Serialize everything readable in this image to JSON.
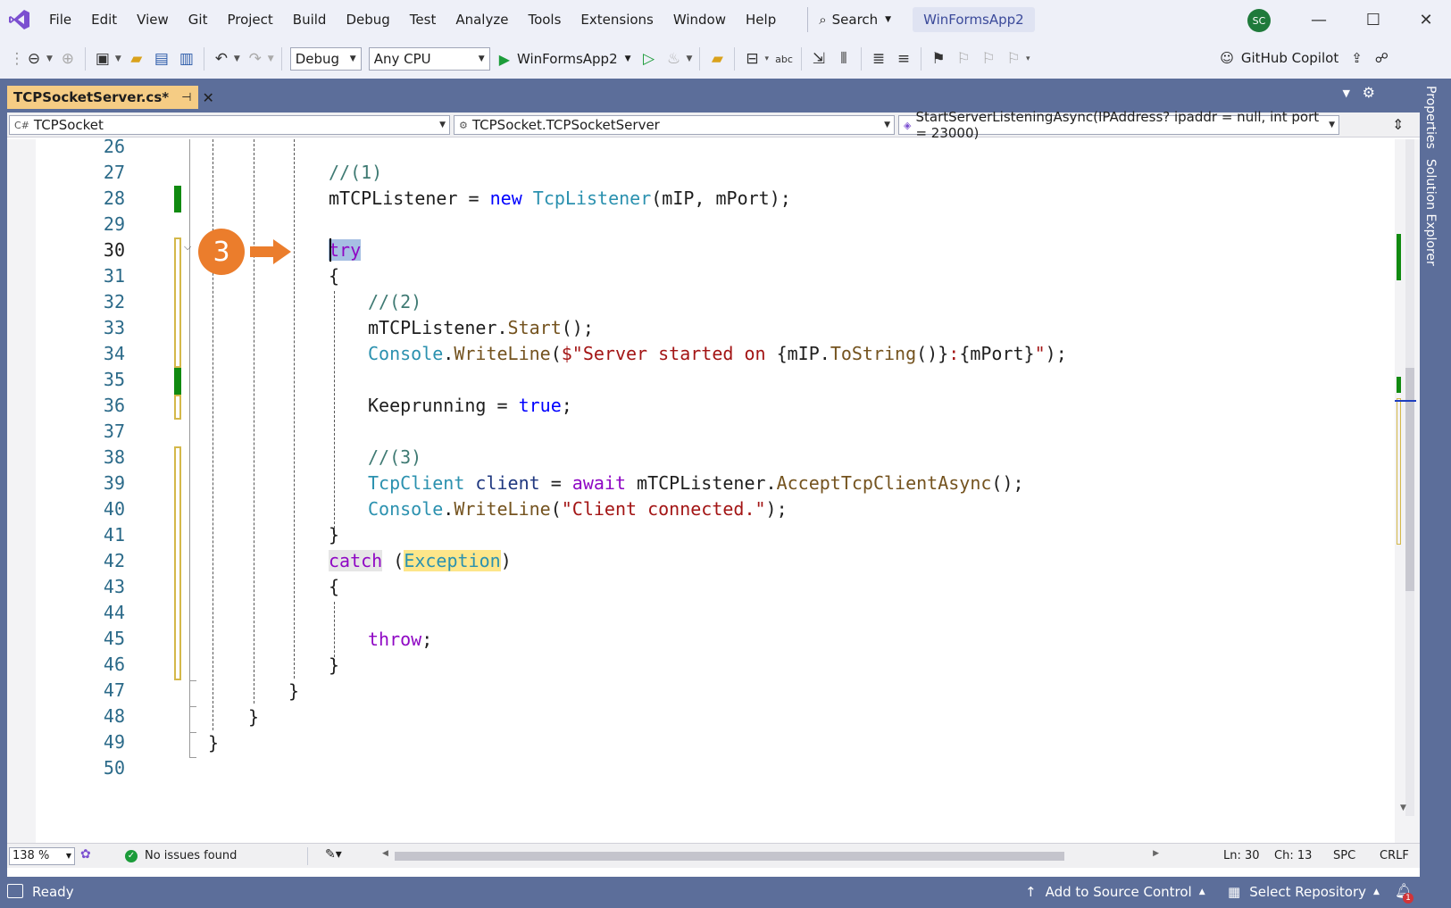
{
  "menu": {
    "items": [
      "File",
      "Edit",
      "View",
      "Git",
      "Project",
      "Build",
      "Debug",
      "Test",
      "Analyze",
      "Tools",
      "Extensions",
      "Window",
      "Help"
    ],
    "search_label": "Search",
    "solution_name": "WinFormsApp2",
    "avatar_initials": "SC"
  },
  "toolbar": {
    "configuration": "Debug",
    "platform": "Any CPU",
    "run_target": "WinFormsApp2",
    "copilot_label": "GitHub Copilot"
  },
  "document_tab": {
    "label": "TCPSocketServer.cs*"
  },
  "side_tabs": [
    "Properties",
    "Solution Explorer"
  ],
  "navbar": {
    "project": "TCPSocket",
    "type": "TCPSocket.TCPSocketServer",
    "member": "StartServerListeningAsync(IPAddress? ipaddr = null, int port = 23000)"
  },
  "editor": {
    "line_numbers": [
      "26",
      "27",
      "28",
      "29",
      "30",
      "31",
      "32",
      "33",
      "34",
      "35",
      "36",
      "37",
      "38",
      "39",
      "40",
      "41",
      "42",
      "43",
      "44",
      "45",
      "46",
      "47",
      "48",
      "49",
      "50"
    ],
    "current_line": "30",
    "step_badge": "3"
  },
  "editor_status": {
    "zoom": "138 %",
    "issues": "No issues found",
    "line": "Ln: 30",
    "col": "Ch: 13",
    "whitespace": "SPC",
    "line_ending": "CRLF"
  },
  "statusbar": {
    "ready": "Ready",
    "add_to_source_control": "Add to Source Control",
    "select_repository": "Select Repository",
    "notification_count": "1"
  },
  "colors": {
    "accent_tab": "#f5cc84",
    "frame": "#5c6e9a",
    "badge": "#eb7d2c"
  }
}
